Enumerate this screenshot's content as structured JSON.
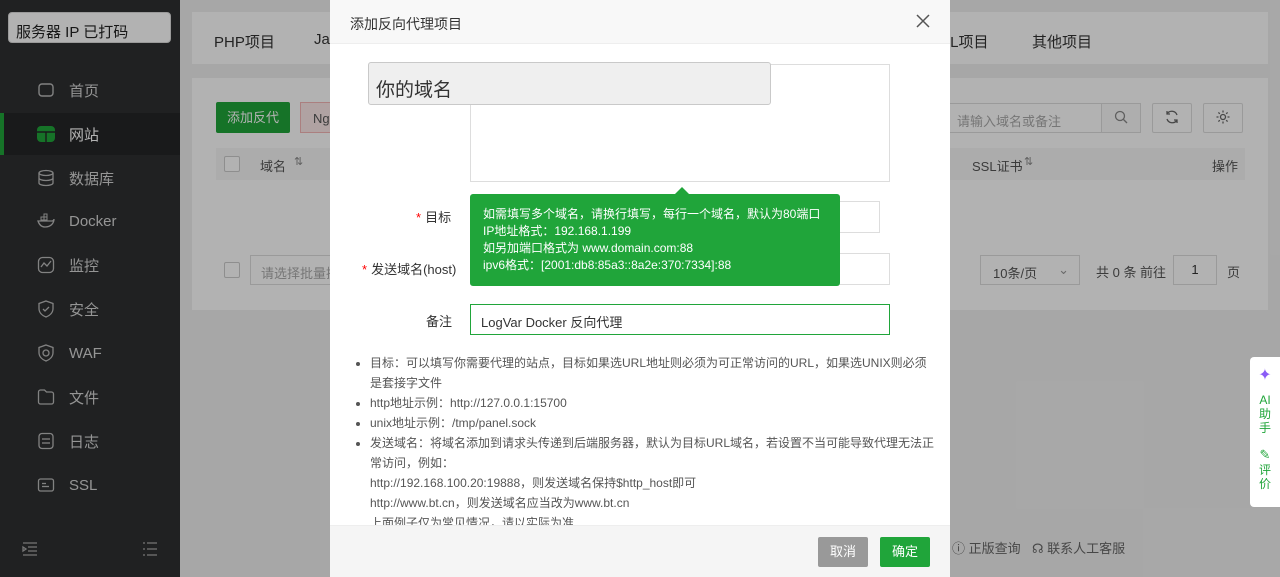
{
  "sidebar": {
    "server_ip": "服务器 IP 已打码",
    "items": [
      {
        "label": "首页",
        "icon": "home-icon"
      },
      {
        "label": "网站",
        "icon": "globe-icon"
      },
      {
        "label": "数据库",
        "icon": "database-icon"
      },
      {
        "label": "Docker",
        "icon": "docker-icon"
      },
      {
        "label": "监控",
        "icon": "monitor-icon"
      },
      {
        "label": "安全",
        "icon": "shield-icon"
      },
      {
        "label": "WAF",
        "icon": "waf-icon"
      },
      {
        "label": "文件",
        "icon": "folder-icon"
      },
      {
        "label": "日志",
        "icon": "log-icon"
      },
      {
        "label": "SSL",
        "icon": "ssl-icon"
      }
    ]
  },
  "tabs": {
    "php": "PHP项目",
    "java": "Ja",
    "html": "IL项目",
    "other": "其他项目"
  },
  "toolbar": {
    "add_proxy": "添加反代",
    "nginx_partial": "Ng",
    "search_placeholder": "请输入域名或备注"
  },
  "table": {
    "col_domain": "域名",
    "col_ssl": "SSL证书",
    "col_ops": "操作"
  },
  "pager": {
    "batch_placeholder": "请选择批量操",
    "page_size": "10条/页",
    "total": "共 0 条",
    "goto": "前往",
    "page": "1",
    "page_unit": "页"
  },
  "footer_links": {
    "verify": "正版查询",
    "support": "联系人工客服"
  },
  "ai_widget": {
    "ai": "AI",
    "assistant": "助手",
    "review": "评价"
  },
  "dialog": {
    "title": "添加反向代理项目",
    "domain_placeholder": "你的域名",
    "target_label": "目标",
    "host_label": "发送域名(host)",
    "remark_label": "备注",
    "remark_value": "LogVar Docker 反向代理",
    "tooltip": [
      "如需填写多个域名，请换行填写，每行一个域名，默认为80端口",
      "IP地址格式：192.168.1.199",
      "如另加端口格式为 www.domain.com:88",
      "ipv6格式：[2001:db8:85a3::8a2e:370:7334]:88"
    ],
    "help": {
      "target": "目标：可以填写你需要代理的站点，目标如果选URL地址则必须为可正常访问的URL，如果选UNIX则必须是套接字文件",
      "http_example": "http地址示例：http://127.0.0.1:15700",
      "unix_example": "unix地址示例：/tmp/panel.sock",
      "host": "发送域名：将域名添加到请求头传递到后端服务器，默认为目标URL域名，若设置不当可能导致代理无法正常访问，例如：",
      "host_ex1": "http://192.168.100.20:19888，则发送域名保持$http_host即可",
      "host_ex2": "http://www.bt.cn，则发送域名应当改为www.bt.cn",
      "note": "上面例子仅为常见情况，请以实际为准"
    },
    "cancel": "取消",
    "confirm": "确定"
  }
}
